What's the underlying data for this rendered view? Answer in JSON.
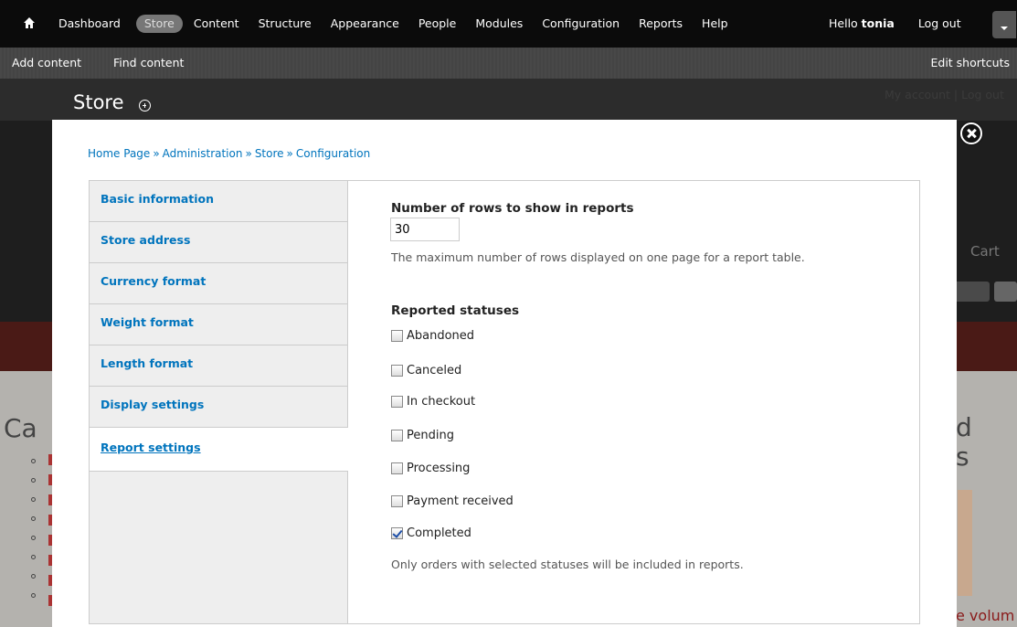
{
  "toolbar": {
    "menu": [
      "Dashboard",
      "Store",
      "Content",
      "Structure",
      "Appearance",
      "People",
      "Modules",
      "Configuration",
      "Reports",
      "Help"
    ],
    "active_item": "Store",
    "greeting": "Hello",
    "username": "tonia",
    "logout": "Log out",
    "shortcuts": {
      "add_content": "Add content",
      "find_content": "Find content",
      "edit_shortcuts": "Edit shortcuts"
    }
  },
  "background": {
    "page_title": "Store",
    "account_links": "My account | Log out",
    "cart_text": "Cart",
    "category_left": "Ca",
    "category_right": "d\ns",
    "volume_text": "e volum"
  },
  "overlay": {
    "breadcrumb": [
      "Home Page",
      "Administration",
      "Store",
      "Configuration"
    ],
    "breadcrumb_separator": "»",
    "vertical_tabs": [
      {
        "label": "Basic information",
        "selected": false
      },
      {
        "label": "Store address",
        "selected": false
      },
      {
        "label": "Currency format",
        "selected": false
      },
      {
        "label": "Weight format",
        "selected": false
      },
      {
        "label": "Length format",
        "selected": false
      },
      {
        "label": "Display settings",
        "selected": false
      },
      {
        "label": "Report settings",
        "selected": true
      }
    ],
    "rows": {
      "label": "Number of rows to show in reports",
      "value": "30",
      "description": "The maximum number of rows displayed on one page for a report table."
    },
    "statuses": {
      "label": "Reported statuses",
      "options": [
        {
          "label": "Abandoned",
          "checked": false
        },
        {
          "label": "Canceled",
          "checked": false
        },
        {
          "label": "In checkout",
          "checked": false
        },
        {
          "label": "Pending",
          "checked": false
        },
        {
          "label": "Processing",
          "checked": false
        },
        {
          "label": "Payment received",
          "checked": false
        },
        {
          "label": "Completed",
          "checked": true
        }
      ],
      "description": "Only orders with selected statuses will be included in reports."
    }
  },
  "colors": {
    "link": "#0074bd",
    "toolbar_bg": "#0b0b0b",
    "shortcuts_bg": "#444444",
    "tabs_bg": "#eeeeee"
  }
}
